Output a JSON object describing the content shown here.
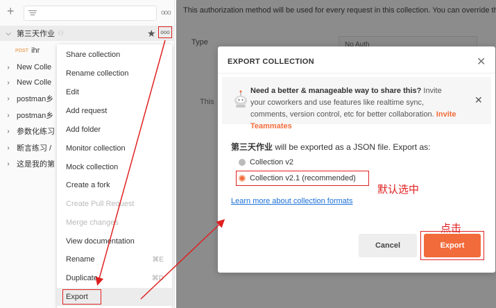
{
  "sidebar": {
    "collections": [
      {
        "name": "第三天作业",
        "shared": true,
        "open": true
      },
      {
        "name": "New Colle"
      },
      {
        "name": "New Colle"
      },
      {
        "name": "postman乡"
      },
      {
        "name": "postman乡"
      },
      {
        "name": "参数化练习"
      },
      {
        "name": "断言练习 /"
      },
      {
        "name": "这是我的第"
      }
    ],
    "request": {
      "method": "POST",
      "name": "ihr"
    }
  },
  "menu": {
    "items": [
      {
        "label": "Share collection"
      },
      {
        "label": "Rename collection"
      },
      {
        "label": "Edit"
      },
      {
        "label": "Add request"
      },
      {
        "label": "Add folder"
      },
      {
        "label": "Monitor collection"
      },
      {
        "label": "Mock collection"
      },
      {
        "label": "Create a fork"
      },
      {
        "label": "Create Pull Request",
        "disabled": true
      },
      {
        "label": "Merge changes",
        "disabled": true
      },
      {
        "label": "View documentation"
      },
      {
        "label": "Rename",
        "shortcut": "⌘E"
      },
      {
        "label": "Duplicate",
        "shortcut": "⌘D"
      },
      {
        "label": "Export"
      }
    ]
  },
  "main": {
    "auth_note": "This authorization method will be used for every request in this collection. You can override this",
    "type_label": "Type",
    "type_value": "No Auth",
    "this_text": "This"
  },
  "modal": {
    "title": "EXPORT COLLECTION",
    "banner": {
      "heading": "Need a better & manageable way to share this?",
      "body": " Invite your coworkers and use features like realtime sync, comments, version control, etc for better collaboration. ",
      "cta": "Invite Teammates"
    },
    "collection_name": "第三天作业",
    "export_suffix": " will be exported as a JSON file. Export as:",
    "options": [
      {
        "label": "Collection v2",
        "selected": false
      },
      {
        "label": "Collection v2.1 (recommended)",
        "selected": true
      }
    ],
    "learn_link": "Learn more about collection formats",
    "cancel_label": "Cancel",
    "export_label": "Export"
  },
  "annotations": {
    "default_selected": "默认选中",
    "click": "点击"
  },
  "colors": {
    "accent": "#f26b3a",
    "annotation_red": "#e02020",
    "link": "#1a6fd8"
  }
}
